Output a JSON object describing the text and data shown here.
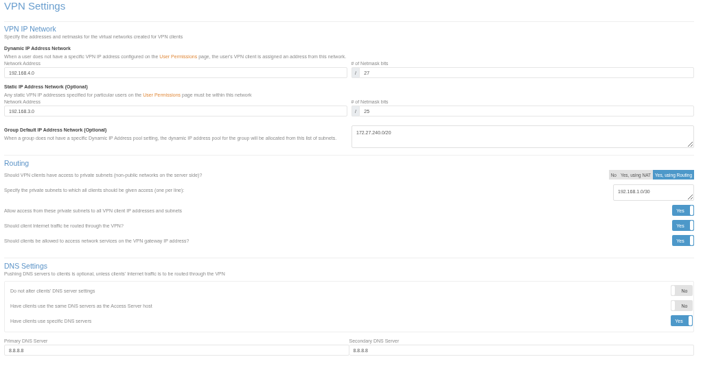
{
  "page_title": "VPN Settings",
  "vpn_ip_network": {
    "title": "VPN IP Network",
    "description": "Specify the addresses and netmasks for the virtual networks created for VPN clients",
    "networks": [
      {
        "kind": "address_mask",
        "heading": "Dynamic IP Address Network",
        "text_before": "When a user does not have a specific VPN IP address configured on the ",
        "link": "User Permissions",
        "text_after": " page, the user's VPN client is assigned an address from this network.",
        "address_label": "Network Address",
        "address": "192.168.4.0",
        "mask_label": "# of Netmask bits",
        "mask_prefix": "/",
        "mask": "27"
      },
      {
        "kind": "address_mask",
        "heading": "Static IP Address Network (Optional)",
        "text_before": "Any static VPN IP addresses specified for particular users on the ",
        "link": "User Permissions",
        "text_after": " page must be within this network",
        "address_label": "Network Address",
        "address": "192.168.3.0",
        "mask_label": "# of Netmask bits",
        "mask_prefix": "/",
        "mask": "25"
      },
      {
        "kind": "pool",
        "heading": "Group Default IP Address Network (Optional)",
        "text_before": "When a group does not have a specific Dynamic IP Address pool setting, the dynamic IP address pool for the group will be allocated from this list of subnets.",
        "value": "172.27.240.0/20"
      }
    ]
  },
  "routing": {
    "title": "Routing",
    "access": {
      "question": "Should VPN clients have access to private subnets (non-public networks on the server side)?",
      "options": [
        {
          "label": "No",
          "selected": false
        },
        {
          "label": "Yes, using NAT",
          "selected": false
        },
        {
          "label": "Yes, using Routing",
          "selected": true
        }
      ]
    },
    "subnets": {
      "label": "Specify the private subnets to which all clients should be given access (one per line):",
      "value": "192.168.1.0/30"
    },
    "toggles": [
      {
        "label": "Allow access from these private subnets to all VPN client IP addresses and subnets",
        "on": true,
        "text": "Yes"
      },
      {
        "label": "Should client Internet traffic be routed through the VPN?",
        "on": true,
        "text": "Yes"
      },
      {
        "label": "Should clients be allowed to access network services on the VPN gateway IP address?",
        "on": true,
        "text": "Yes"
      }
    ]
  },
  "dns": {
    "title": "DNS Settings",
    "description": "Pushing DNS servers to clients is optional, unless clients' Internet traffic is to be routed through the VPN",
    "options": [
      {
        "label": "Do not alter clients' DNS server settings",
        "on": false,
        "text": "No"
      },
      {
        "label": "Have clients use the same DNS servers as the Access Server host",
        "on": false,
        "text": "No"
      },
      {
        "label": "Have clients use specific DNS servers",
        "on": true,
        "text": "Yes"
      }
    ],
    "servers": [
      {
        "label": "Primary DNS Server",
        "value": "8.8.8.8"
      },
      {
        "label": "Secondary DNS Server",
        "value": "8.8.8.8"
      }
    ]
  }
}
